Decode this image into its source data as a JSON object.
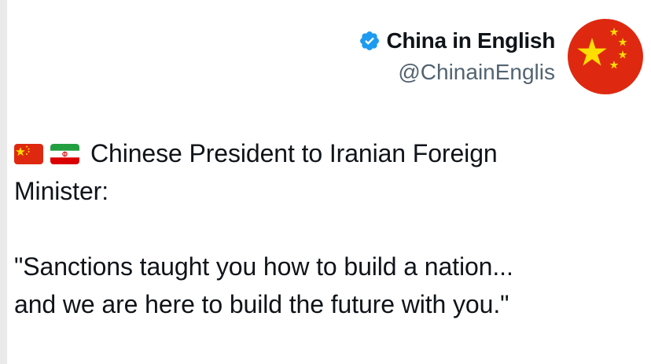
{
  "author": {
    "display_name": "China in English",
    "handle": "@ChinainEnglis",
    "verified_icon": "verified-badge-icon",
    "avatar_icon": "china-flag-icon"
  },
  "tweet": {
    "flags": [
      "china-flag-icon",
      "iran-flag-icon"
    ],
    "line1": "Chinese President to Iranian Foreign",
    "line2": "Minister:",
    "line3": "\"Sanctions taught you how to build a nation...",
    "line4": "and we are here to build the future with you.\""
  },
  "colors": {
    "text": "#0f1419",
    "handle": "#536471",
    "verified": "#1d9bf0",
    "china_red": "#de2910",
    "china_star": "#ffde00",
    "iran_green": "#239f40",
    "iran_red": "#da0000"
  }
}
